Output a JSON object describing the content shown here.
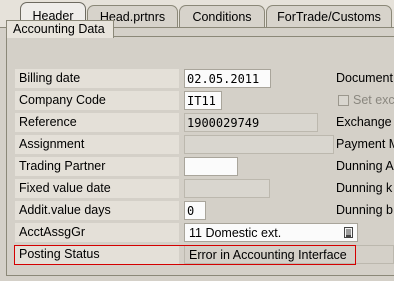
{
  "tabs": [
    {
      "label": "Header",
      "active": true
    },
    {
      "label": "Head.prtnrs",
      "active": false
    },
    {
      "label": "Conditions",
      "active": false
    },
    {
      "label": "ForTrade/Customs",
      "active": false
    }
  ],
  "group": {
    "title": "Accounting Data"
  },
  "rows": {
    "billing_date": {
      "label": "Billing date",
      "value": "02.05.2011"
    },
    "company_code": {
      "label": "Company Code",
      "value": "IT11"
    },
    "reference": {
      "label": "Reference",
      "value": "1900029749"
    },
    "assignment": {
      "label": "Assignment",
      "value": ""
    },
    "trading_partner": {
      "label": "Trading Partner",
      "value": ""
    },
    "fixed_value_date": {
      "label": "Fixed value date",
      "value": ""
    },
    "addit_value_days": {
      "label": "Addit.value days",
      "value": "0"
    },
    "acct_assg_gr": {
      "label": "AcctAssgGr",
      "value": "11 Domestic ext."
    },
    "posting_status": {
      "label": "Posting Status",
      "value": "Error in Accounting Interface"
    }
  },
  "right_labels": {
    "document": "Document",
    "set_exc": "Set exc",
    "exchange": "Exchange",
    "payment": "Payment M",
    "dunning_a": "Dunning A",
    "dunning_k": "Dunning k",
    "dunning_b": "Dunning b"
  },
  "colors": {
    "highlight": "#d40000"
  }
}
